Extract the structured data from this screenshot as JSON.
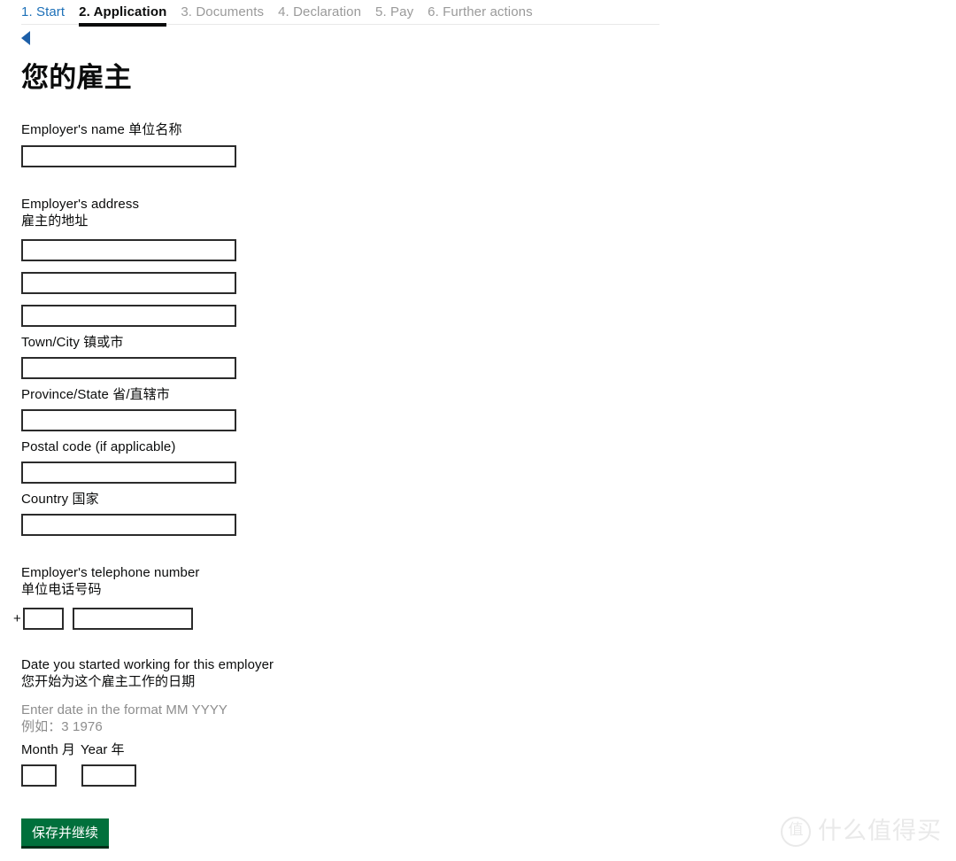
{
  "nav": {
    "tabs": [
      {
        "label": "1. Start",
        "state": "link"
      },
      {
        "label": "2. Application",
        "state": "active"
      },
      {
        "label": "3. Documents",
        "state": "muted"
      },
      {
        "label": "4. Declaration",
        "state": "muted"
      },
      {
        "label": "5. Pay",
        "state": "muted"
      },
      {
        "label": "6. Further actions",
        "state": "muted"
      }
    ],
    "back_icon": "back-arrow-icon"
  },
  "page": {
    "title": "您的雇主"
  },
  "form": {
    "employer_name": {
      "label": "Employer's name 单位名称",
      "value": "",
      "placeholder": ""
    },
    "employer_address": {
      "label_en": "Employer's address",
      "label_zh": "雇主的地址",
      "lines": [
        {
          "value": "",
          "placeholder": ""
        },
        {
          "value": "",
          "placeholder": ""
        },
        {
          "value": "",
          "placeholder": ""
        }
      ]
    },
    "town_city": {
      "label": "Town/City 镇或市",
      "value": "",
      "placeholder": ""
    },
    "province_state": {
      "label": "Province/State 省/直辖市",
      "value": "",
      "placeholder": ""
    },
    "postal_code": {
      "label": "Postal code (if applicable)",
      "value": "",
      "placeholder": ""
    },
    "country": {
      "label": "Country 国家",
      "value": "",
      "placeholder": ""
    },
    "telephone": {
      "label_en": "Employer's telephone number",
      "label_zh": "单位电话号码",
      "prefix": "+",
      "country_code": {
        "value": "",
        "placeholder": ""
      },
      "number": {
        "value": "",
        "placeholder": ""
      }
    },
    "start_date": {
      "label_en": "Date you started working for this employer",
      "label_zh": "您开始为这个雇主工作的日期",
      "hint_en": "Enter date in the format MM YYYY",
      "hint_zh": "例如：3 1976",
      "month_label": "Month 月",
      "year_label": "Year 年",
      "month": {
        "value": "",
        "placeholder": ""
      },
      "year": {
        "value": "",
        "placeholder": ""
      }
    }
  },
  "actions": {
    "save_label": "保存并继续"
  },
  "watermark": {
    "badge": "值",
    "text": "什么值得买"
  },
  "colors": {
    "link_blue": "#1d70b8",
    "active_black": "#0b0c0c",
    "muted_grey": "#9a9a9a",
    "hint_grey": "#8d8d8d",
    "button_green": "#00703c",
    "button_shadow": "#002d18",
    "input_border": "#2b2b2b",
    "back_arrow_blue": "#1d5fa8"
  }
}
